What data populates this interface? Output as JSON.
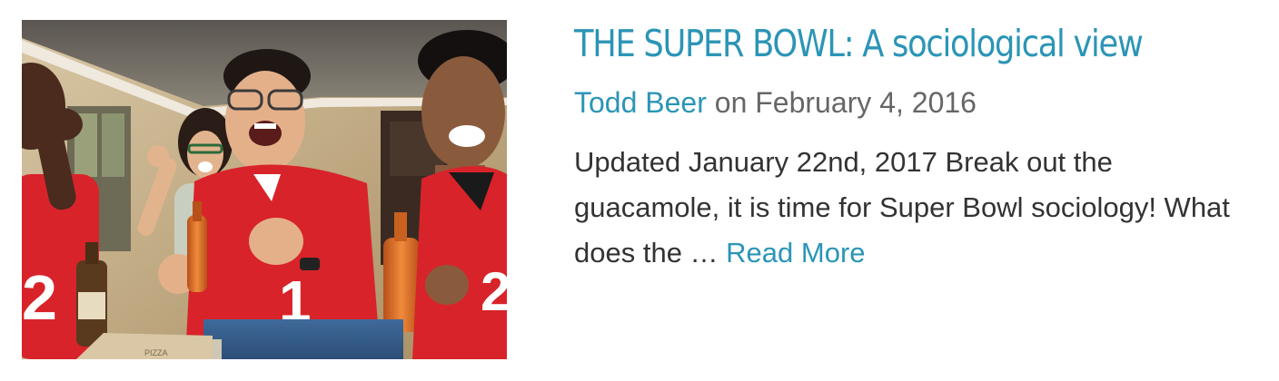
{
  "post": {
    "title": "THE SUPER BOWL: A sociological view",
    "author": "Todd Beer",
    "date_prefix": "on",
    "date": "February 4, 2016",
    "excerpt": "Updated January 22nd, 2017 Break out the guacamole, it is time for Super Bowl sociology! What does the …",
    "read_more": "Read More",
    "image_alt": "Fans in red football jerseys cheering while watching the Super Bowl",
    "jersey_number": "1",
    "pizza_box_text": "PIZZA"
  },
  "colors": {
    "link": "#2b95b6",
    "body_text": "#333333",
    "meta_text": "#666666",
    "jersey_red": "#d8232a"
  }
}
